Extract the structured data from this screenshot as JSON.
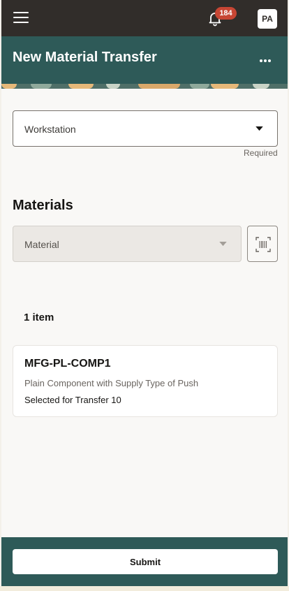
{
  "topbar": {
    "menu_icon": "hamburger-icon",
    "notifications_icon": "bell-icon",
    "notification_count": "184",
    "user_initials": "PA"
  },
  "header": {
    "title": "New Material Transfer",
    "actions_icon": "more-horizontal-icon"
  },
  "form": {
    "workstation": {
      "label": "Workstation",
      "helper": "Required",
      "icon": "caret-down-icon"
    }
  },
  "materials": {
    "section_title": "Materials",
    "material_select": {
      "label": "Material",
      "icon": "caret-down-icon"
    },
    "scan_icon": "barcode-scan-icon",
    "count_label": "1 item",
    "items": [
      {
        "code": "MFG-PL-COMP1",
        "description": "Plain Component with Supply Type of Push",
        "status": "Selected for Transfer 10"
      }
    ]
  },
  "footer": {
    "submit_label": "Submit"
  },
  "colors": {
    "topbar": "#312d2a",
    "header": "#2e5a58",
    "badge": "#c74634",
    "background": "#f9f8f6"
  }
}
